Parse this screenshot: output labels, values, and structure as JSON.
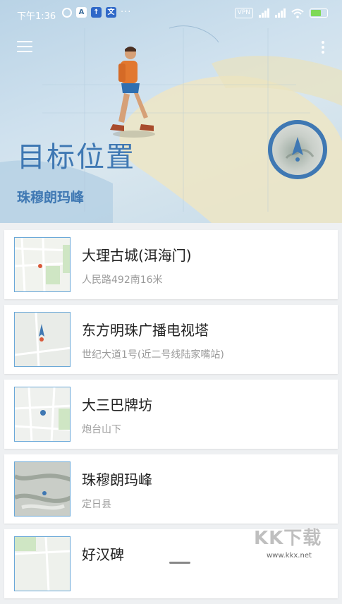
{
  "status_bar": {
    "time": "下午1:36",
    "dots": "···",
    "vpn": "VPN",
    "icon_names": [
      "alarm-icon",
      "a-app-icon",
      "upload-icon",
      "translate-icon",
      "signal-icon",
      "wifi-icon",
      "battery-icon"
    ]
  },
  "header": {
    "title": "目标位置",
    "target_name": "珠穆朗玛峰",
    "accent_color": "#3f78b3"
  },
  "list": {
    "items": [
      {
        "title": "大理古城(洱海门)",
        "subtitle": "人民路492南16米"
      },
      {
        "title": "东方明珠广播电视塔",
        "subtitle": "世纪大道1号(近二号线陆家嘴站)"
      },
      {
        "title": "大三巴牌坊",
        "subtitle": "炮台山下"
      },
      {
        "title": "珠穆朗玛峰",
        "subtitle": "定日县"
      },
      {
        "title": "好汉碑",
        "subtitle": ""
      }
    ]
  },
  "watermark": {
    "text": "KK下载",
    "url": "www.kkx.net"
  }
}
